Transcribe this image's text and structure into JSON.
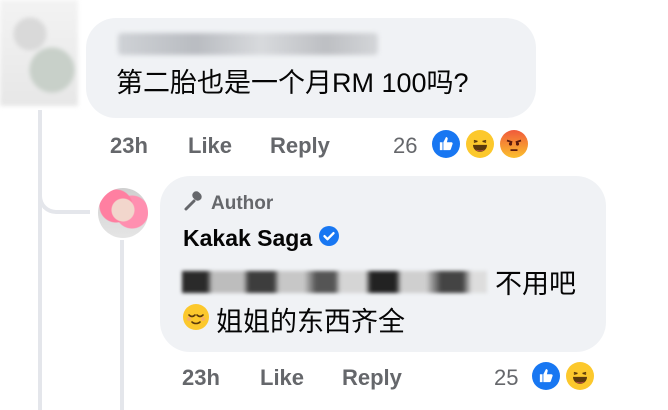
{
  "comment1": {
    "text": "第二胎也是一个月RM 100吗?",
    "time": "23h",
    "like_label": "Like",
    "reply_label": "Reply",
    "reaction_count": "26",
    "reactions": [
      "like-icon",
      "haha-icon",
      "angry-icon"
    ]
  },
  "comment2": {
    "author_badge": "Author",
    "author_name": "Kakak Saga",
    "text_suffix": "不用吧",
    "text_line2": "姐姐的东西齐全",
    "time": "23h",
    "like_label": "Like",
    "reply_label": "Reply",
    "reaction_count": "25",
    "reactions": [
      "like-icon",
      "haha-icon"
    ]
  },
  "colors": {
    "bubble": "#f0f2f5",
    "meta_text": "#65676b",
    "like_blue": "#1877f2",
    "verified_blue": "#1877f2"
  }
}
